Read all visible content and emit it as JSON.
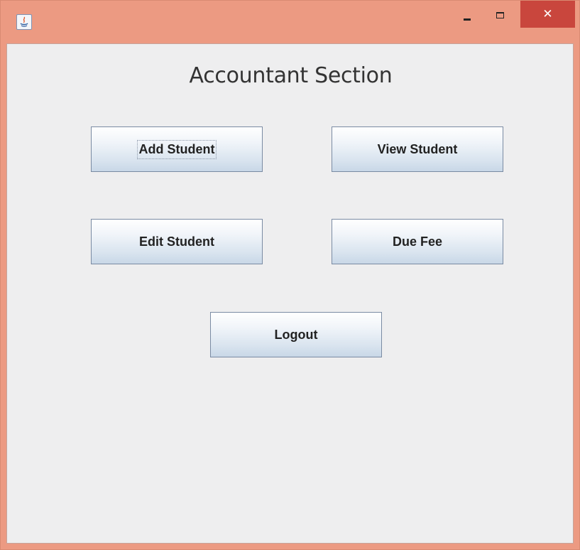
{
  "window": {
    "title": "",
    "controls": {
      "minimize_icon": "minimize-icon",
      "maximize_icon": "maximize-icon",
      "close_label": "✕"
    },
    "colors": {
      "frame": "#ec9a82",
      "close": "#c9463d",
      "client": "#eeeeef"
    }
  },
  "main": {
    "heading": "Accountant Section",
    "buttons": {
      "add_student": "Add Student",
      "view_student": "View Student",
      "edit_student": "Edit Student",
      "due_fee": "Due Fee",
      "logout": "Logout"
    },
    "focused_button": "Add Student"
  }
}
